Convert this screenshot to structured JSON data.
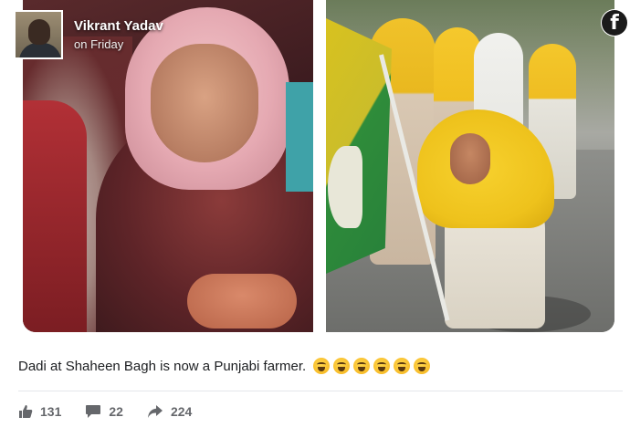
{
  "post": {
    "author": "Vikrant Yadav",
    "timestamp": "on Friday",
    "caption": "Dadi at Shaheen Bagh is now a Punjabi farmer.",
    "emojis": [
      "crying-face",
      "crying-face",
      "laughing-face",
      "laughing-face",
      "rolling-laughing-face",
      "rolling-laughing-face"
    ]
  },
  "brand": {
    "logo_letter": "f"
  },
  "actions": {
    "likes": "131",
    "comments": "22",
    "shares": "224"
  },
  "colors": {
    "icon_gray": "#65676b",
    "divider": "#e4e6eb"
  }
}
